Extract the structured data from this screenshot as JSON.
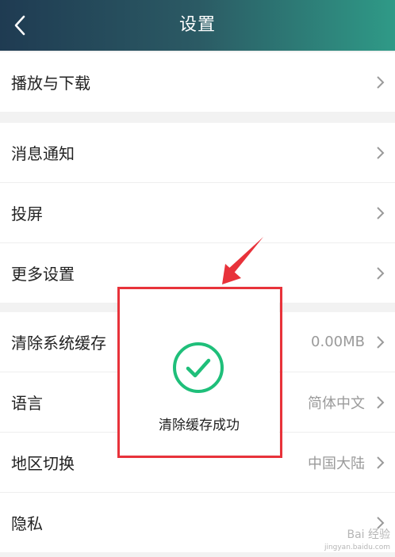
{
  "header": {
    "title": "设置",
    "back_icon": "chevron-left-icon"
  },
  "groups": [
    {
      "items": [
        {
          "label": "播放与下载",
          "value": ""
        }
      ]
    },
    {
      "items": [
        {
          "label": "消息通知",
          "value": ""
        },
        {
          "label": "投屏",
          "value": ""
        },
        {
          "label": "更多设置",
          "value": ""
        }
      ]
    },
    {
      "items": [
        {
          "label": "清除系统缓存",
          "value": "0.00MB"
        },
        {
          "label": "语言",
          "value": "简体中文"
        },
        {
          "label": "地区切换",
          "value": "中国大陆"
        },
        {
          "label": "隐私",
          "value": ""
        }
      ]
    }
  ],
  "toast": {
    "text": "清除缓存成功",
    "icon": "check-circle-icon",
    "accent": "#1fbf7a"
  },
  "annotation": {
    "color": "#e8323a"
  },
  "watermark": {
    "text": "Bai 经验",
    "sub": "jingyan.baidu.com"
  },
  "colors": {
    "header_start": "#1f3b52",
    "header_end": "#2f9a87"
  }
}
